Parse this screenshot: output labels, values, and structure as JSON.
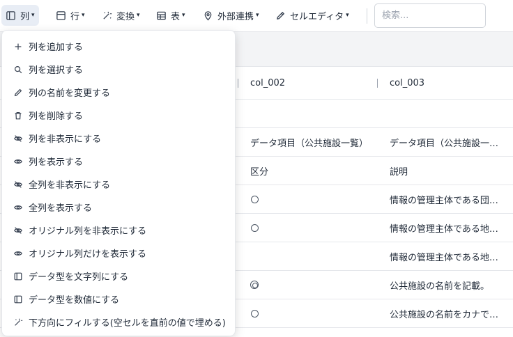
{
  "toolbar": {
    "items": [
      {
        "label": "列",
        "icon": "column-panel-icon"
      },
      {
        "label": "行",
        "icon": "row-panel-icon"
      },
      {
        "label": "変換",
        "icon": "magic-wand-icon"
      },
      {
        "label": "表",
        "icon": "table-icon"
      },
      {
        "label": "外部連携",
        "icon": "map-pin-icon"
      },
      {
        "label": "セルエディタ",
        "icon": "pencil-icon"
      }
    ],
    "caret": "▾",
    "search_placeholder": "検索..."
  },
  "table": {
    "headers": [
      "col_002",
      "col_003"
    ],
    "rows": [
      [
        "データ項目（公共施設一覧）",
        "データ項目（公共施設一覧）"
      ],
      [
        "区分",
        "説明"
      ],
      [
        "○",
        "情報の管理主体である団体の…"
      ],
      [
        "○",
        "情報の管理主体である地方公共団体…"
      ],
      [
        "",
        "情報の管理主体である地方公共団体…"
      ],
      [
        "◎",
        "公共施設の名前を記載。"
      ],
      [
        "○",
        "公共施設の名前をカナで記載…"
      ]
    ]
  },
  "menu": {
    "items": [
      {
        "label": "列を追加する",
        "icon": "plus-icon"
      },
      {
        "label": "列を選択する",
        "icon": "search-icon"
      },
      {
        "label": "列の名前を変更する",
        "icon": "pencil-icon"
      },
      {
        "label": "列を削除する",
        "icon": "trash-icon"
      },
      {
        "label": "列を非表示にする",
        "icon": "eye-off-icon"
      },
      {
        "label": "列を表示する",
        "icon": "eye-icon"
      },
      {
        "label": "全列を非表示にする",
        "icon": "eye-off-icon"
      },
      {
        "label": "全列を表示する",
        "icon": "eye-icon"
      },
      {
        "label": "オリジナル列を非表示にする",
        "icon": "eye-off-icon"
      },
      {
        "label": "オリジナル列だけを表示する",
        "icon": "eye-icon"
      },
      {
        "label": "データ型を文字列にする",
        "icon": "column-panel-icon"
      },
      {
        "label": "データ型を数値にする",
        "icon": "column-panel-icon"
      },
      {
        "label": "下方向にフィルする(空セルを直前の値で埋める)",
        "icon": "magic-wand-icon"
      }
    ]
  }
}
